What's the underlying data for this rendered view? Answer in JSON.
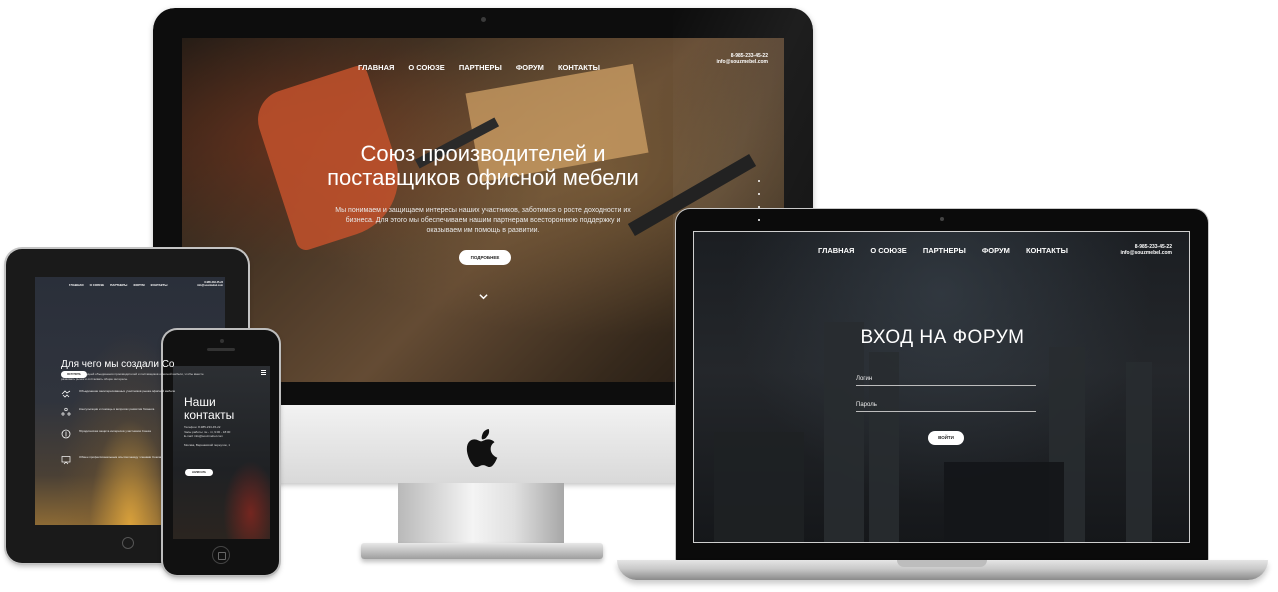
{
  "imac": {
    "nav": [
      "ГЛАВНАЯ",
      "О СОЮЗЕ",
      "ПАРТНЕРЫ",
      "ФОРУМ",
      "КОНТАКТЫ"
    ],
    "contact": {
      "phone": "8-985-233-45-22",
      "email": "info@souzmebel.com"
    },
    "hero_title_line1": "Союз производителей и",
    "hero_title_line2": "поставщиков офисной мебели",
    "hero_description": "Мы понимаем и защищаем интересы наших участников, заботимся о росте доходности их бизнеса. Для этого мы обеспечиваем нашим партнерам всестороннюю поддержку и оказываем им помощь в развитии.",
    "more_button": "ПОДРОБНЕЕ"
  },
  "laptop": {
    "nav": [
      "ГЛАВНАЯ",
      "О СОЮЗЕ",
      "ПАРТНЕРЫ",
      "ФОРУМ",
      "КОНТАКТЫ"
    ],
    "contact": {
      "phone": "8-985-233-45-22",
      "email": "info@souzmebel.com"
    },
    "form_title": "ВХОД НА ФОРУМ",
    "login_placeholder": "Логин",
    "password_placeholder": "Пароль",
    "login_button": "ВОЙТИ"
  },
  "tablet": {
    "nav": [
      "ГЛАВНАЯ",
      "О СОЮЗЕ",
      "ПАРТНЕРЫ",
      "ФОРУМ",
      "КОНТАКТЫ"
    ],
    "contact_short": "8-985-233-45-22 info@souzmebel.com",
    "title": "Для чего мы создали Со",
    "text": "Мы вдохновлены идеей объединения производителей и поставщиков офисной мебели, чтобы вместе развивать рынок и отстаивать общие интересы.",
    "button": "ВСТУПИТЬ",
    "features": [
      "Объединение заинтересованных участников рынка офисной мебели",
      "Консультации и помощь в вопросах развития бизнеса",
      "Юридическая защита интересов участников Союза",
      "Обмен профессиональным опытом между членами Союза"
    ]
  },
  "phone": {
    "title_line1": "Наши",
    "title_line2": "контакты",
    "info_phone": "Телефон: 8-985-233-45-22",
    "info_hours": "Часы работы: пн - пт, 9:00 - 18:00",
    "info_email": "E-mail: info@souzmebel.com",
    "info_address": "Москва, Варшавский переулок, 1",
    "button": "НАПИСАТЬ"
  }
}
